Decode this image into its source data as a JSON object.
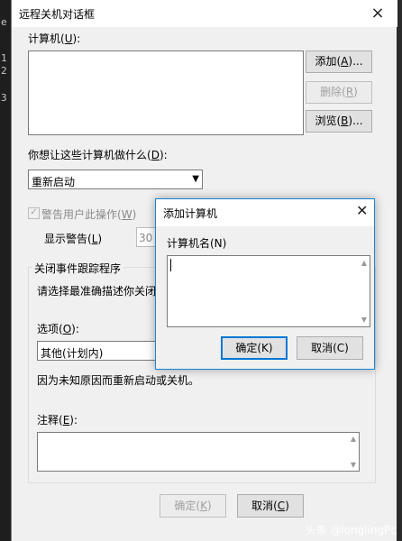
{
  "console": {
    "lines": [
      "e",
      "1",
      "2",
      "3"
    ]
  },
  "main_dialog": {
    "title": "远程关机对话框",
    "close_glyph": "×",
    "computers_label_prefix": "计算机(",
    "computers_label_key": "U",
    "computers_label_suffix": "):",
    "buttons": {
      "add_prefix": "添加(",
      "add_key": "A",
      "add_suffix": ")...",
      "delete_prefix": "删除(",
      "delete_key": "R",
      "delete_suffix": ")",
      "browse_prefix": "浏览(",
      "browse_key": "B",
      "browse_suffix": ")..."
    },
    "action_label_prefix": "你想让这些计算机做什么(",
    "action_label_key": "D",
    "action_label_suffix": "):",
    "action_value": "重新启动",
    "warn_checkbox_prefix": "警告用户此操作(",
    "warn_checkbox_key": "W",
    "warn_checkbox_suffix": ")",
    "show_warning_prefix": "显示警告(",
    "show_warning_key": "L",
    "show_warning_suffix": ")",
    "warning_seconds": "30",
    "tracker_group_title": "关闭事件跟踪程序",
    "tracker_desc": "请选择最准确描述你关闭计",
    "option_label_prefix": "选项(",
    "option_label_key": "O",
    "option_label_suffix": "):",
    "option_value": "其他(计划内)",
    "option_desc": "因为未知原因而重新启动或关机。",
    "comment_label_prefix": "注释(",
    "comment_label_key": "E",
    "comment_label_suffix": "):",
    "ok_prefix": "确定(",
    "ok_key": "K",
    "ok_suffix": ")",
    "cancel_prefix": "取消(",
    "cancel_key": "C",
    "cancel_suffix": ")"
  },
  "add_dialog": {
    "title": "添加计算机",
    "close_glyph": "✕",
    "name_label": "计算机名(N)",
    "ok_label": "确定(K)",
    "cancel_label": "取消(C)"
  },
  "watermark": {
    "text": "头条 @longlingPc"
  }
}
